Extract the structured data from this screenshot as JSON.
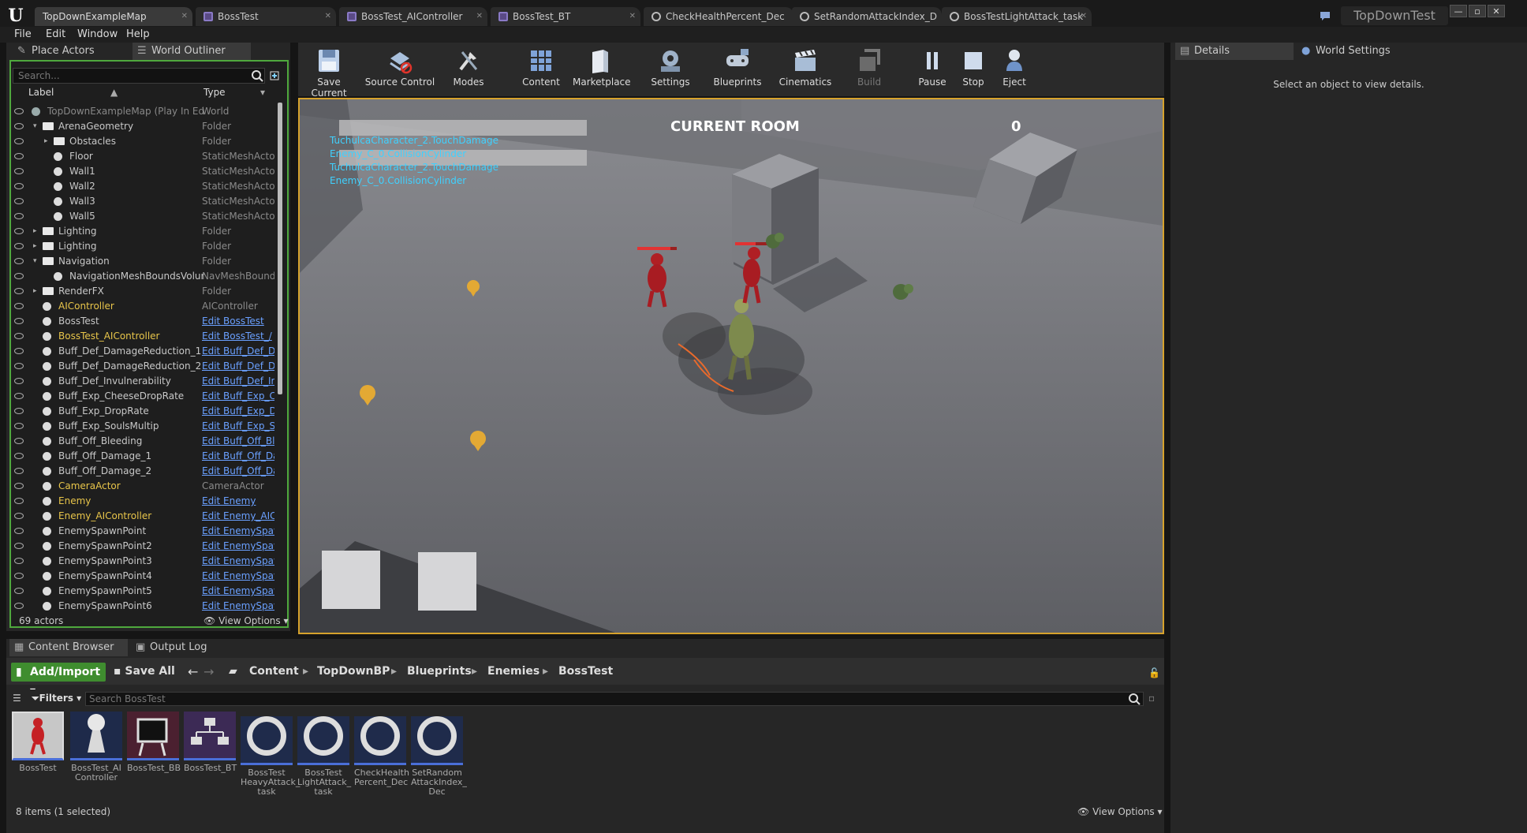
{
  "titlebar": {
    "tabs": [
      {
        "label": "TopDownExampleMap"
      },
      {
        "label": "BossTest"
      },
      {
        "label": "BossTest_AIController"
      },
      {
        "label": "BossTest_BT"
      },
      {
        "label": "CheckHealthPercent_Dec"
      },
      {
        "label": "SetRandomAttackIndex_D"
      },
      {
        "label": "BossTestLightAttack_task"
      }
    ],
    "project": "TopDownTest"
  },
  "menu": {
    "items": [
      "File",
      "Edit",
      "Window",
      "Help"
    ]
  },
  "left": {
    "tabs": [
      "Place Actors",
      "World Outliner"
    ],
    "search_placeholder": "Search...",
    "columns": {
      "label": "Label",
      "type": "Type"
    },
    "rows": [
      {
        "label": "TopDownExampleMap (Play In Ed",
        "type": "World"
      },
      {
        "label": "ArenaGeometry",
        "type": "Folder"
      },
      {
        "label": "Obstacles",
        "type": "Folder"
      },
      {
        "label": "Floor",
        "type": "StaticMeshActor"
      },
      {
        "label": "Wall1",
        "type": "StaticMeshActor"
      },
      {
        "label": "Wall2",
        "type": "StaticMeshActor"
      },
      {
        "label": "Wall3",
        "type": "StaticMeshActor"
      },
      {
        "label": "Wall5",
        "type": "StaticMeshActor"
      },
      {
        "label": "Lighting",
        "type": "Folder"
      },
      {
        "label": "Lighting",
        "type": "Folder"
      },
      {
        "label": "Navigation",
        "type": "Folder"
      },
      {
        "label": "NavigationMeshBoundsVolur",
        "type": "NavMeshBounds"
      },
      {
        "label": "RenderFX",
        "type": "Folder"
      },
      {
        "label": "AIController",
        "type": "AIController"
      },
      {
        "label": "BossTest",
        "type": "Edit BossTest"
      },
      {
        "label": "BossTest_AIController",
        "type": "Edit BossTest_/"
      },
      {
        "label": "Buff_Def_DamageReduction_1",
        "type": "Edit Buff_Def_D"
      },
      {
        "label": "Buff_Def_DamageReduction_2",
        "type": "Edit Buff_Def_D"
      },
      {
        "label": "Buff_Def_Invulnerability",
        "type": "Edit Buff_Def_Ir"
      },
      {
        "label": "Buff_Exp_CheeseDropRate",
        "type": "Edit Buff_Exp_C"
      },
      {
        "label": "Buff_Exp_DropRate",
        "type": "Edit Buff_Exp_D"
      },
      {
        "label": "Buff_Exp_SoulsMultip",
        "type": "Edit Buff_Exp_S"
      },
      {
        "label": "Buff_Off_Bleeding",
        "type": "Edit Buff_Off_Bl"
      },
      {
        "label": "Buff_Off_Damage_1",
        "type": "Edit Buff_Off_Da"
      },
      {
        "label": "Buff_Off_Damage_2",
        "type": "Edit Buff_Off_Da"
      },
      {
        "label": "CameraActor",
        "type": "CameraActor"
      },
      {
        "label": "Enemy",
        "type": "Edit Enemy"
      },
      {
        "label": "Enemy_AIController",
        "type": "Edit Enemy_AIC"
      },
      {
        "label": "EnemySpawnPoint",
        "type": "Edit EnemySpav"
      },
      {
        "label": "EnemySpawnPoint2",
        "type": "Edit EnemySpav"
      },
      {
        "label": "EnemySpawnPoint3",
        "type": "Edit EnemySpav"
      },
      {
        "label": "EnemySpawnPoint4",
        "type": "Edit EnemySpav"
      },
      {
        "label": "EnemySpawnPoint5",
        "type": "Edit EnemySpav"
      },
      {
        "label": "EnemySpawnPoint6",
        "type": "Edit EnemySpav"
      }
    ],
    "actor_count": "69 actors",
    "view_options": "View Options"
  },
  "toolbar": {
    "buttons": [
      "Save Current",
      "Source Control",
      "Modes",
      "Content",
      "Marketplace",
      "Settings",
      "Blueprints",
      "Cinematics",
      "Build",
      "Pause",
      "Stop",
      "Eject"
    ]
  },
  "viewport": {
    "room_label": "CURRENT ROOM",
    "room_value": "0",
    "debug_lines": [
      "TuchulcaCharacter_2.TouchDamage",
      "Enemy_C_0.CollisionCylinder",
      "TuchulcaCharacter_2.TouchDamage",
      "Enemy_C_0.CollisionCylinder"
    ]
  },
  "right": {
    "tabs": [
      "Details",
      "World Settings"
    ],
    "empty_text": "Select an object to view details."
  },
  "bottom": {
    "tabs": [
      "Content Browser",
      "Output Log"
    ],
    "add_import": "Add/Import",
    "save_all": "Save All",
    "breadcrumbs": [
      "Content",
      "TopDownBP",
      "Blueprints",
      "Enemies",
      "BossTest"
    ],
    "filters": "Filters",
    "search_placeholder": "Search BossTest",
    "assets": [
      {
        "label": "BossTest"
      },
      {
        "label": "BossTest_AI Controller"
      },
      {
        "label": "BossTest_BB"
      },
      {
        "label": "BossTest_BT"
      },
      {
        "label": "BossTest HeavyAttack_ task"
      },
      {
        "label": "BossTest LightAttack_ task"
      },
      {
        "label": "CheckHealth Percent_Dec"
      },
      {
        "label": "SetRandom AttackIndex_ Dec"
      }
    ],
    "item_count": "8 items (1 selected)",
    "view_options": "View Options"
  }
}
